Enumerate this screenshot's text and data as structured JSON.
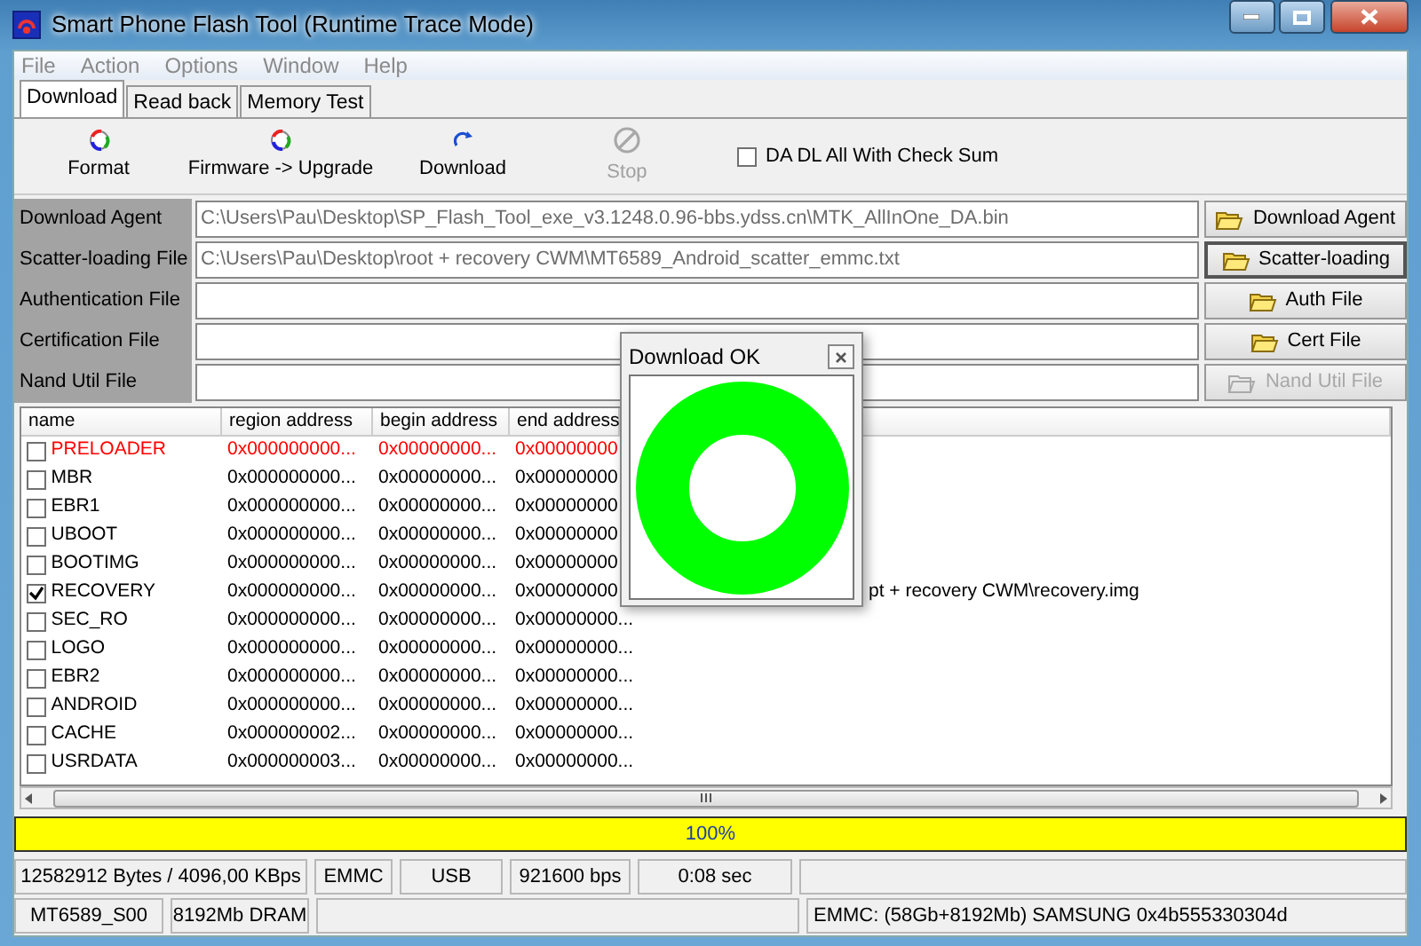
{
  "window": {
    "title": "Smart Phone Flash Tool (Runtime Trace Mode)"
  },
  "menu": [
    "File",
    "Action",
    "Options",
    "Window",
    "Help"
  ],
  "tabs": [
    {
      "label": "Download",
      "selected": true
    },
    {
      "label": "Read back",
      "selected": false
    },
    {
      "label": "Memory Test",
      "selected": false
    }
  ],
  "toolbar": [
    {
      "label": "Format",
      "kind": "format",
      "disabled": false
    },
    {
      "label": "Firmware -> Upgrade",
      "kind": "format",
      "disabled": false
    },
    {
      "label": "Download",
      "kind": "download",
      "disabled": false
    },
    {
      "label": "Stop",
      "kind": "stop",
      "disabled": true
    }
  ],
  "checksum": {
    "label": "DA DL All With Check Sum",
    "checked": false
  },
  "files": [
    {
      "label": "Download Agent",
      "value": "C:\\Users\\Pau\\Desktop\\SP_Flash_Tool_exe_v3.1248.0.96-bbs.ydss.cn\\MTK_AllInOne_DA.bin",
      "button": "Download Agent",
      "focused": false,
      "disabled": false
    },
    {
      "label": "Scatter-loading File",
      "value": "C:\\Users\\Pau\\Desktop\\root + recovery CWM\\MT6589_Android_scatter_emmc.txt",
      "button": "Scatter-loading",
      "focused": true,
      "disabled": false
    },
    {
      "label": "Authentication File",
      "button": "Auth File",
      "focused": false,
      "disabled": false
    },
    {
      "label": "Certification File",
      "button": "Cert File",
      "focused": false,
      "disabled": false
    },
    {
      "label": "Nand Util File",
      "button": "Nand Util File",
      "focused": false,
      "disabled": true
    }
  ],
  "table": {
    "columns": [
      "name",
      "region address",
      "begin address",
      "end address"
    ],
    "rows": [
      {
        "checked": false,
        "color": "#ff0000",
        "cells": [
          "PRELOADER",
          "0x000000000...",
          "0x00000000...",
          "0x00000000"
        ]
      },
      {
        "checked": false,
        "color": "#000000",
        "cells": [
          "MBR",
          "0x000000000...",
          "0x00000000...",
          "0x00000000"
        ]
      },
      {
        "checked": false,
        "color": "#000000",
        "cells": [
          "EBR1",
          "0x000000000...",
          "0x00000000...",
          "0x00000000"
        ]
      },
      {
        "checked": false,
        "color": "#000000",
        "cells": [
          "UBOOT",
          "0x000000000...",
          "0x00000000...",
          "0x00000000"
        ]
      },
      {
        "checked": false,
        "color": "#000000",
        "cells": [
          "BOOTIMG",
          "0x000000000...",
          "0x00000000...",
          "0x00000000"
        ]
      },
      {
        "checked": true,
        "color": "#000000",
        "cells": [
          "RECOVERY",
          "0x000000000...",
          "0x00000000...",
          "0x00000000"
        ],
        "location": "pt + recovery CWM\\recovery.img"
      },
      {
        "checked": false,
        "color": "#000000",
        "cells": [
          "SEC_RO",
          "0x000000000...",
          "0x00000000...",
          "0x00000000..."
        ]
      },
      {
        "checked": false,
        "color": "#000000",
        "cells": [
          "LOGO",
          "0x000000000...",
          "0x00000000...",
          "0x00000000..."
        ]
      },
      {
        "checked": false,
        "color": "#000000",
        "cells": [
          "EBR2",
          "0x000000000...",
          "0x00000000...",
          "0x00000000..."
        ]
      },
      {
        "checked": false,
        "color": "#000000",
        "cells": [
          "ANDROID",
          "0x000000000...",
          "0x00000000...",
          "0x00000000..."
        ]
      },
      {
        "checked": false,
        "color": "#000000",
        "cells": [
          "CACHE",
          "0x000000002...",
          "0x00000000...",
          "0x00000000..."
        ]
      },
      {
        "checked": false,
        "color": "#000000",
        "cells": [
          "USRDATA",
          "0x000000003...",
          "0x00000000...",
          "0x00000000..."
        ]
      }
    ]
  },
  "dialog": {
    "title": "Download OK"
  },
  "progress": {
    "level": 1,
    "label": "100%"
  },
  "status": [
    [
      "12582912 Bytes / 4096,00 KBps",
      "EMMC",
      "USB",
      "921600 bps",
      "0:08 sec"
    ],
    [
      "MT6589_S00",
      "8192Mb DRAM",
      "EMMC: (58Gb+8192Mb) SAMSUNG 0x4b555330304d"
    ]
  ]
}
